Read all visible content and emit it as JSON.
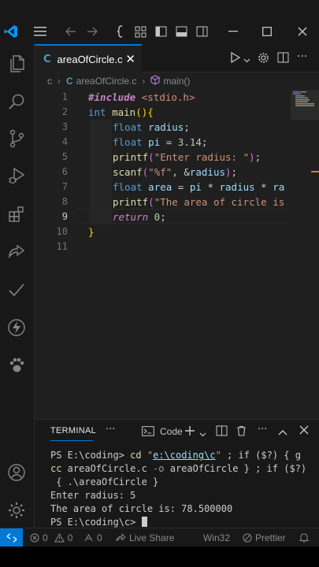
{
  "colors": {
    "accent": "#0078d4",
    "editor_bg": "#1f1f1f",
    "chrome_bg": "#181818",
    "keyword": "#569cd6",
    "string": "#ce9178",
    "function": "#dcdcaa",
    "variable": "#9cdcfe"
  },
  "titlebar": {
    "icons": [
      "vscode-logo-icon",
      "hamburger-menu-icon",
      "back-arrow-icon",
      "forward-arrow-icon",
      "copilot-icon",
      "customize-layout-icon",
      "toggle-primary-sidebar-icon",
      "toggle-panel-icon",
      "toggle-secondary-sidebar-icon",
      "minimize-icon",
      "maximize-icon",
      "close-icon"
    ]
  },
  "activity_bar": {
    "items": [
      "explorer-icon",
      "search-icon",
      "source-control-icon",
      "run-debug-icon",
      "extensions-icon",
      "remote-explorer-icon",
      "testing-icon",
      "thunder-client-icon",
      "paw-extension-icon",
      "accounts-icon",
      "manage-gear-icon"
    ]
  },
  "tab": {
    "lang_glyph": "C",
    "label": "areaOfCircle.c",
    "close": "✕"
  },
  "breadcrumb": {
    "folder": "c",
    "sep": "›",
    "file_glyph": "C",
    "file": "areaOfCircle.c",
    "symbol": "main()"
  },
  "editor": {
    "line_numbers": [
      "1",
      "2",
      "3",
      "4",
      "5",
      "6",
      "7",
      "8",
      "9",
      "10",
      "11"
    ],
    "current_line": "9",
    "lines": {
      "l1": {
        "pp": "#include",
        "str": " <stdio.h>"
      },
      "l2": {
        "kw": "int",
        "fn": " main",
        "b1": "(",
        "b2": ")",
        "b3": "{"
      },
      "l3": {
        "kw": "float",
        "var": " radius",
        "rest": ";"
      },
      "l4": {
        "kw": "float",
        "var": " pi",
        "eq": " = ",
        "num": "3.14",
        "rest": ";"
      },
      "l5": {
        "fn": "printf",
        "b1": "(",
        "str": "\"Enter radius: \"",
        "b2": ")",
        "rest": ";"
      },
      "l6": {
        "fn": "scanf",
        "b1": "(",
        "str": "\"%f\"",
        "mid": ", &",
        "var": "radius",
        "b2": ")",
        "rest": ";"
      },
      "l7": {
        "kw": "float",
        "var1": " area",
        "eq": " = ",
        "var2": "pi",
        "op1": " * ",
        "var3": "radius",
        "op2": " * ",
        "var4": "ra"
      },
      "l8": {
        "fn": "printf",
        "b1": "(",
        "str": "\"The area of circle is"
      },
      "l9": {
        "ct": "return",
        "num": " 0",
        "rest": ";"
      },
      "l10": {
        "b": "}"
      }
    }
  },
  "panel": {
    "title": "TERMINAL",
    "more": "···",
    "profile_label": "Code",
    "lines": {
      "t1_prompt": "PS E:\\coding> ",
      "t1_cmd": "cd",
      "t1_space": " ",
      "t1_q1": "\"",
      "t1_link": "e:\\coding\\c",
      "t1_q2": "\"",
      "t1_rest": " ; if ($?) { g",
      "t2_cc": "cc",
      "t2_args": " areaOfCircle.c ",
      "t2_flag": "-o",
      "t2_rest": " areaOfCircle } ; if ($?)",
      "t3": " { .\\areaOfCircle }",
      "t4": "Enter radius: 5",
      "t5": "The area of circle is: 78.500000",
      "t6_prompt": "PS E:\\coding\\c> "
    }
  },
  "statusbar": {
    "errors": "0",
    "warnings": "0",
    "ports": "0",
    "live_share": "Live Share",
    "platform": "Win32",
    "prettier": "Prettier"
  }
}
